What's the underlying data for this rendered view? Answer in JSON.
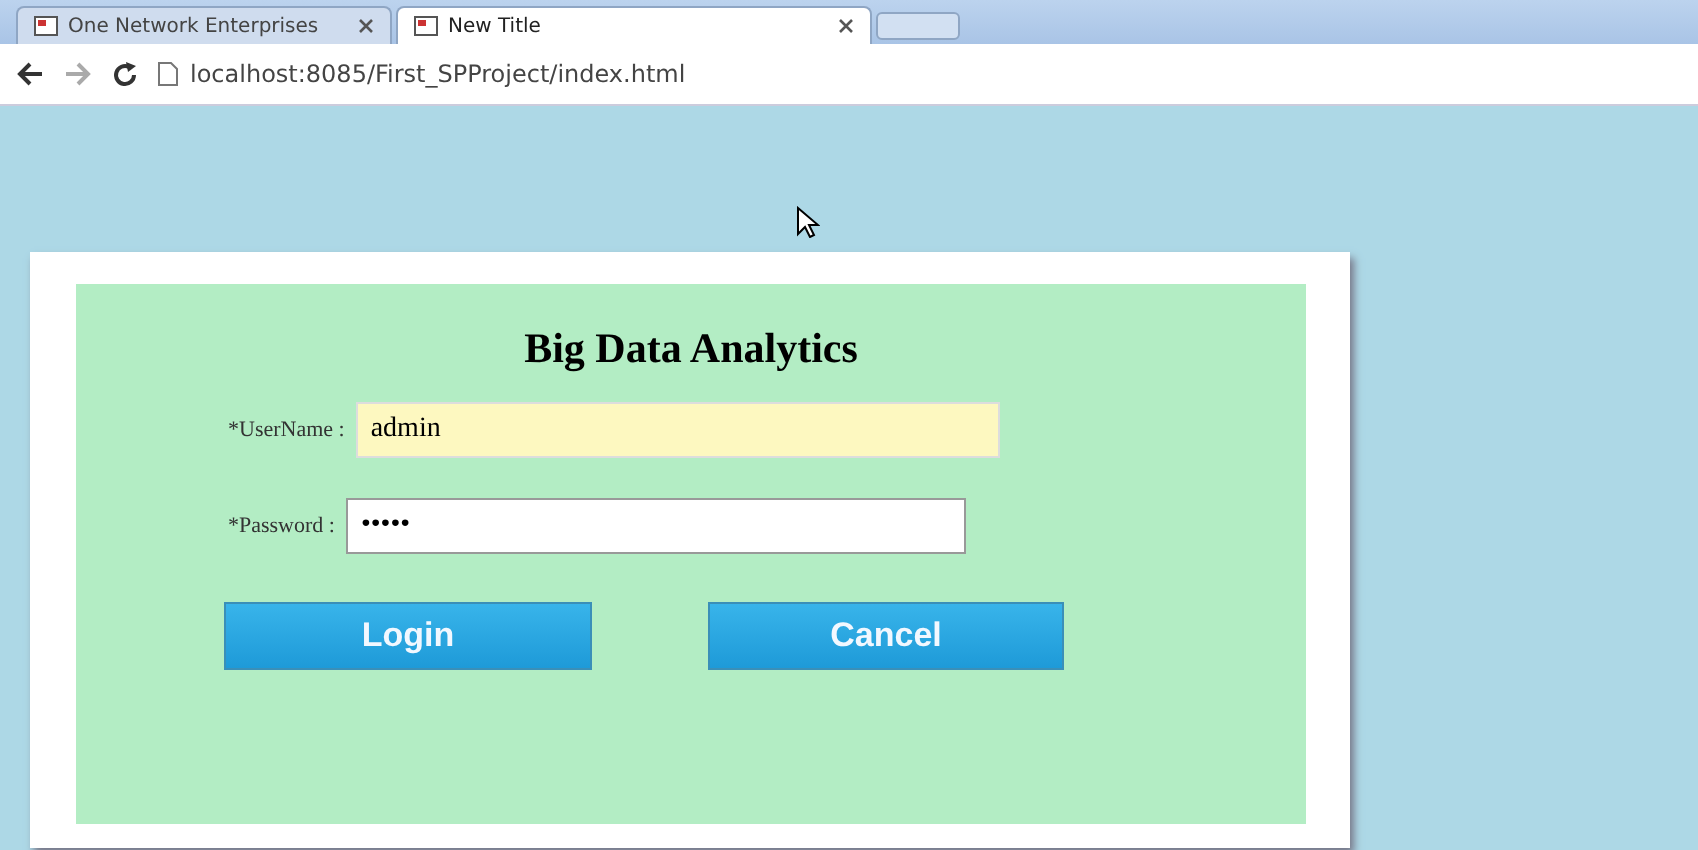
{
  "browser": {
    "tabs": [
      {
        "title": "One Network Enterprises",
        "selected": false
      },
      {
        "title": "New Title",
        "selected": true
      }
    ],
    "address": "localhost:8085/First_SPProject/index.html"
  },
  "login": {
    "heading": "Big Data Analytics",
    "fields": [
      {
        "label": "*UserName :",
        "value": "admin",
        "autofilled": true
      },
      {
        "label": "*Password :",
        "value": "•••••",
        "autofilled": false
      }
    ],
    "buttons": [
      "Login",
      "Cancel"
    ]
  }
}
